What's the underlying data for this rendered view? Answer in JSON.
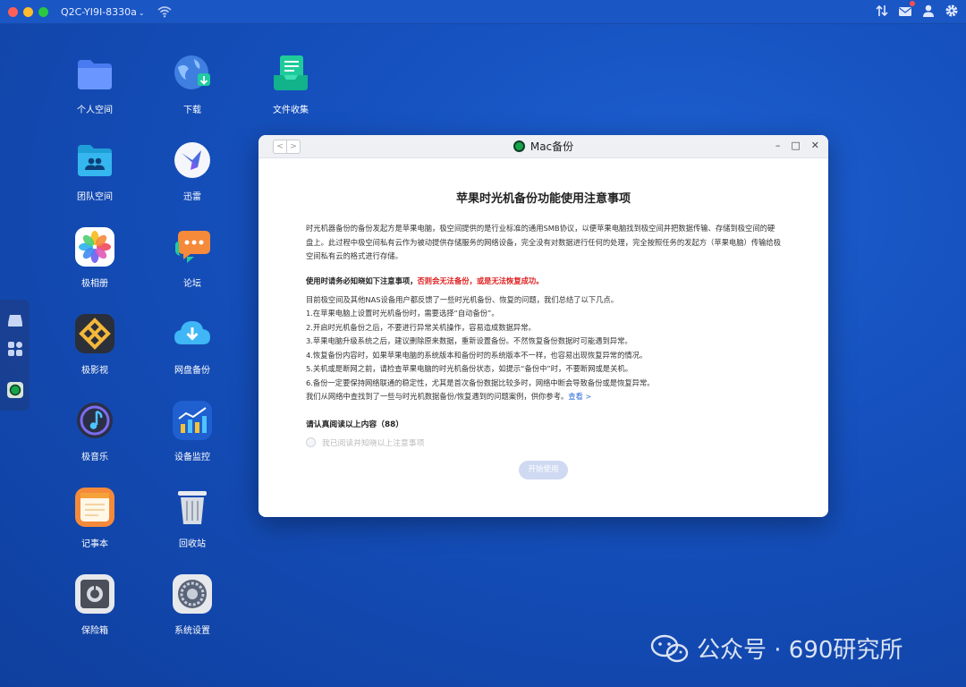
{
  "topbar": {
    "device_name": "Q2C-YI9I-8330a",
    "chevron": "⌄"
  },
  "desktop": {
    "icons": [
      {
        "label": "个人空间"
      },
      {
        "label": "下载"
      },
      {
        "label": "文件收集"
      },
      {
        "label": "团队空间"
      },
      {
        "label": "迅雷"
      },
      {
        "label": "极相册"
      },
      {
        "label": "论坛"
      },
      {
        "label": "极影视"
      },
      {
        "label": "网盘备份"
      },
      {
        "label": "极音乐"
      },
      {
        "label": "设备监控"
      },
      {
        "label": "记事本"
      },
      {
        "label": "回收站"
      },
      {
        "label": "保险箱"
      },
      {
        "label": "系统设置"
      }
    ]
  },
  "window": {
    "title": "Mac备份",
    "nav_back": "<",
    "nav_forward": ">",
    "ctrl_min": "–",
    "ctrl_max": "□",
    "ctrl_close": "✕",
    "doc_title": "苹果时光机备份功能使用注意事项",
    "intro": "时光机器备份的备份发起方是苹果电脑，极空间提供的是行业标准的通用SMB协议，以便苹果电脑找到极空间并把数据传输、存储到极空间的硬盘上。此过程中极空间私有云作为被动提供存储服务的网络设备，完全没有对数据进行任何的处理，完全按照任务的发起方（苹果电脑）传输给极空间私有云的格式进行存储。",
    "warn_prefix": "使用时请务必知晓如下注意事项，",
    "warn_red": "否则会无法备份，或是无法恢复成功。",
    "list": [
      "目前极空间及其他NAS设备用户都反馈了一些时光机备份、恢复的问题，我们总结了以下几点。",
      "1.在苹果电脑上设置时光机备份时，需要选择“自动备份”。",
      "2.开启时光机备份之后，不要进行异常关机操作，容易造成数据异常。",
      "3.苹果电脑升级系统之后，建议删除原来数据，重新设置备份。不然恢复备份数据时可能遇到异常。",
      "4.恢复备份内容时，如果苹果电脑的系统版本和备份时的系统版本不一样，也容易出现恢复异常的情况。",
      "5.关机或是断网之前，请检查苹果电脑的时光机备份状态，如提示“备份中”时，不要断网或是关机。",
      "6.备份一定要保持网络联通的稳定性，尤其是首次备份数据比较多时，网络中断会导致备份或是恢复异常。"
    ],
    "final_line": "我们从网络中查找到了一些与时光机数据备份/恢复遇到的问题案例，供你参考。",
    "view_link": "查看 >",
    "read_title": "请认真阅读以上内容（88）",
    "agree_label": "我已阅读并知晓以上注意事项",
    "start_button": "开始使用"
  },
  "watermark": {
    "text": "公众号 · 690研究所"
  }
}
